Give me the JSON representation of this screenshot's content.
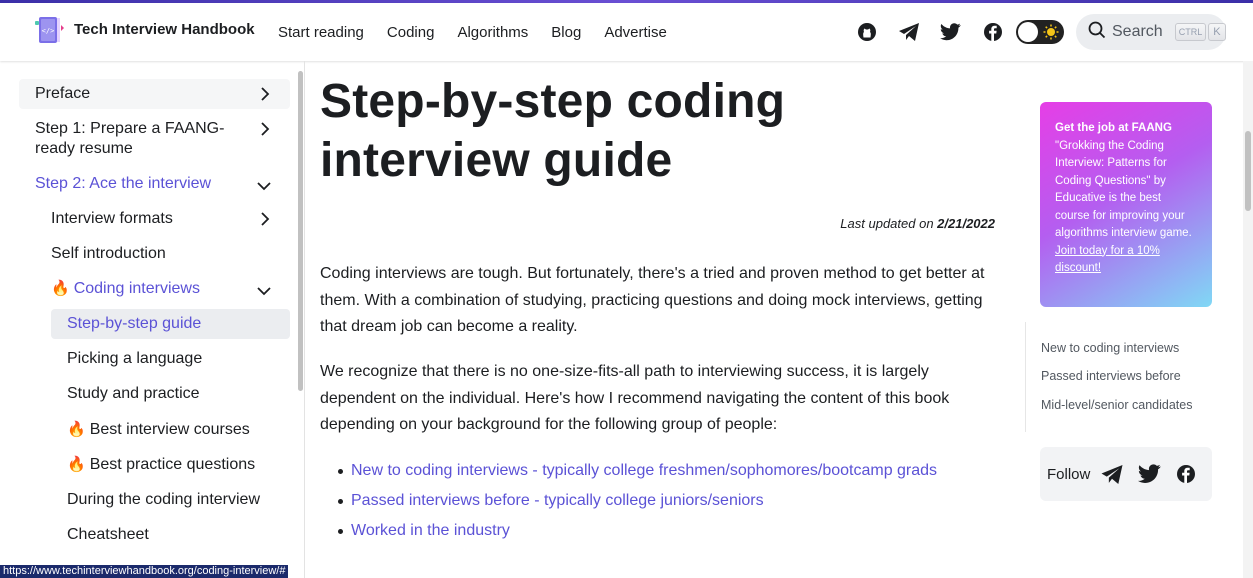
{
  "brand": {
    "name": "Tech Interview Handbook"
  },
  "nav": {
    "links": [
      "Start reading",
      "Coding",
      "Algorithms",
      "Blog",
      "Advertise"
    ],
    "icons": [
      "github-icon",
      "telegram-icon",
      "twitter-icon",
      "facebook-icon"
    ],
    "search_label": "Search",
    "kbd_ctrl": "CTRL",
    "kbd_k": "K"
  },
  "sidebar": {
    "items": [
      {
        "label": "Preface"
      },
      {
        "label": "Step 1: Prepare a FAANG-"
      },
      {
        "label": "ready resume"
      },
      {
        "label": "Step 2: Ace the interview"
      },
      {
        "label": "Interview formats"
      },
      {
        "label": "Self introduction"
      },
      {
        "label": "Coding interviews"
      },
      {
        "label": "Step-by-step guide"
      },
      {
        "label": "Picking a language"
      },
      {
        "label": "Study and practice"
      },
      {
        "label": "Best interview courses"
      },
      {
        "label": "Best practice questions"
      },
      {
        "label": "During the coding interview"
      },
      {
        "label": "Cheatsheet"
      }
    ]
  },
  "main": {
    "title": "Step-by-step coding interview guide",
    "updated_prefix": "Last updated on ",
    "updated_date": "2/21/2022",
    "para1": "Coding interviews are tough. But fortunately, there's a tried and proven method to get better at them. With a combination of studying, practicing questions and doing mock interviews, getting that dream job can become a reality.",
    "para2": "We recognize that there is no one-size-fits-all path to interviewing success, it is largely dependent on the individual. Here's how I recommend navigating the content of this book depending on your background for the following group of people:",
    "bullets": [
      "New to coding interviews - typically college freshmen/sophomores/bootcamp grads",
      "Passed interviews before - typically college juniors/seniors",
      "Worked in the industry"
    ]
  },
  "ad": {
    "heading": "Get the job at FAANG",
    "body": "\"Grokking the Coding Interview: Patterns for Coding Questions\" by Educative is the best course for improving your algorithms interview game. ",
    "link": "Join today for a 10% discount!"
  },
  "toc": [
    "New to coding interviews",
    "Passed interviews before",
    "Mid-level/senior candidates"
  ],
  "follow": {
    "label": "Follow"
  },
  "status_url": "https://www.techinterviewhandbook.org/coding-interview/#",
  "colors": {
    "accent": "#5b52d6",
    "text": "#1c1e21",
    "status_bar": "#1b2a6b"
  }
}
